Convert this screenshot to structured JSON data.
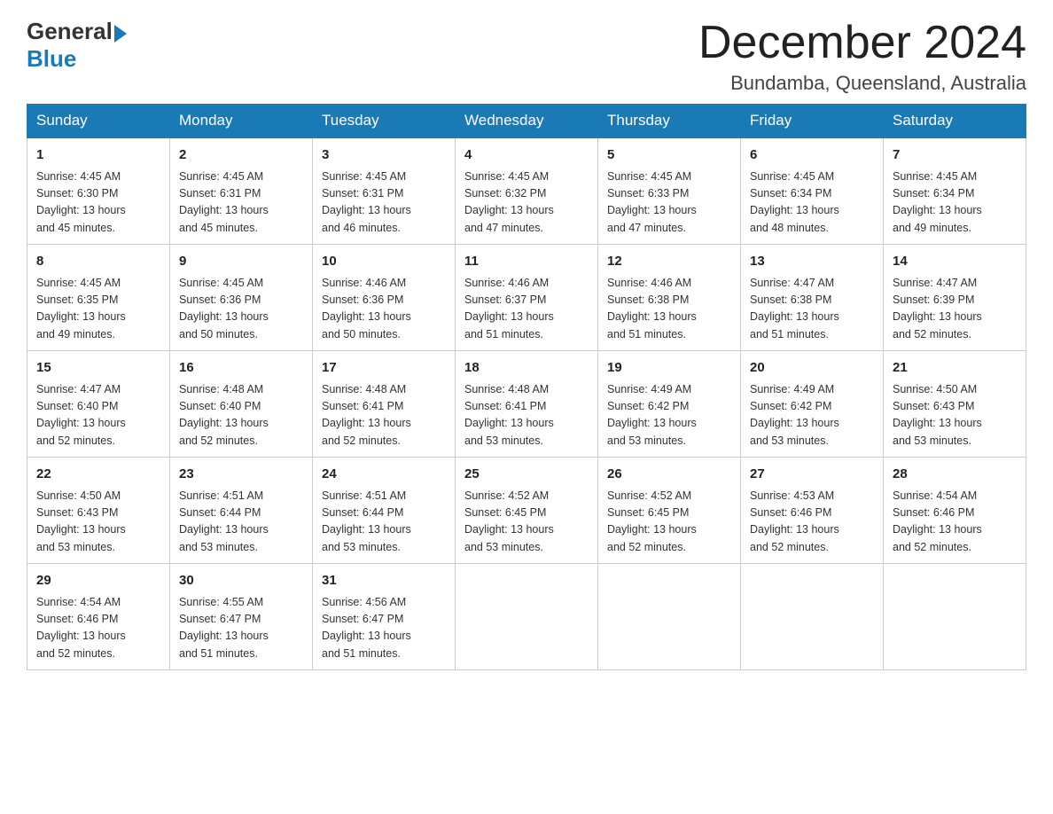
{
  "header": {
    "logo_general": "General",
    "logo_blue": "Blue",
    "title": "December 2024",
    "subtitle": "Bundamba, Queensland, Australia"
  },
  "days_of_week": [
    "Sunday",
    "Monday",
    "Tuesday",
    "Wednesday",
    "Thursday",
    "Friday",
    "Saturday"
  ],
  "weeks": [
    [
      {
        "day": "1",
        "sunrise": "4:45 AM",
        "sunset": "6:30 PM",
        "daylight": "13 hours and 45 minutes."
      },
      {
        "day": "2",
        "sunrise": "4:45 AM",
        "sunset": "6:31 PM",
        "daylight": "13 hours and 45 minutes."
      },
      {
        "day": "3",
        "sunrise": "4:45 AM",
        "sunset": "6:31 PM",
        "daylight": "13 hours and 46 minutes."
      },
      {
        "day": "4",
        "sunrise": "4:45 AM",
        "sunset": "6:32 PM",
        "daylight": "13 hours and 47 minutes."
      },
      {
        "day": "5",
        "sunrise": "4:45 AM",
        "sunset": "6:33 PM",
        "daylight": "13 hours and 47 minutes."
      },
      {
        "day": "6",
        "sunrise": "4:45 AM",
        "sunset": "6:34 PM",
        "daylight": "13 hours and 48 minutes."
      },
      {
        "day": "7",
        "sunrise": "4:45 AM",
        "sunset": "6:34 PM",
        "daylight": "13 hours and 49 minutes."
      }
    ],
    [
      {
        "day": "8",
        "sunrise": "4:45 AM",
        "sunset": "6:35 PM",
        "daylight": "13 hours and 49 minutes."
      },
      {
        "day": "9",
        "sunrise": "4:45 AM",
        "sunset": "6:36 PM",
        "daylight": "13 hours and 50 minutes."
      },
      {
        "day": "10",
        "sunrise": "4:46 AM",
        "sunset": "6:36 PM",
        "daylight": "13 hours and 50 minutes."
      },
      {
        "day": "11",
        "sunrise": "4:46 AM",
        "sunset": "6:37 PM",
        "daylight": "13 hours and 51 minutes."
      },
      {
        "day": "12",
        "sunrise": "4:46 AM",
        "sunset": "6:38 PM",
        "daylight": "13 hours and 51 minutes."
      },
      {
        "day": "13",
        "sunrise": "4:47 AM",
        "sunset": "6:38 PM",
        "daylight": "13 hours and 51 minutes."
      },
      {
        "day": "14",
        "sunrise": "4:47 AM",
        "sunset": "6:39 PM",
        "daylight": "13 hours and 52 minutes."
      }
    ],
    [
      {
        "day": "15",
        "sunrise": "4:47 AM",
        "sunset": "6:40 PM",
        "daylight": "13 hours and 52 minutes."
      },
      {
        "day": "16",
        "sunrise": "4:48 AM",
        "sunset": "6:40 PM",
        "daylight": "13 hours and 52 minutes."
      },
      {
        "day": "17",
        "sunrise": "4:48 AM",
        "sunset": "6:41 PM",
        "daylight": "13 hours and 52 minutes."
      },
      {
        "day": "18",
        "sunrise": "4:48 AM",
        "sunset": "6:41 PM",
        "daylight": "13 hours and 53 minutes."
      },
      {
        "day": "19",
        "sunrise": "4:49 AM",
        "sunset": "6:42 PM",
        "daylight": "13 hours and 53 minutes."
      },
      {
        "day": "20",
        "sunrise": "4:49 AM",
        "sunset": "6:42 PM",
        "daylight": "13 hours and 53 minutes."
      },
      {
        "day": "21",
        "sunrise": "4:50 AM",
        "sunset": "6:43 PM",
        "daylight": "13 hours and 53 minutes."
      }
    ],
    [
      {
        "day": "22",
        "sunrise": "4:50 AM",
        "sunset": "6:43 PM",
        "daylight": "13 hours and 53 minutes."
      },
      {
        "day": "23",
        "sunrise": "4:51 AM",
        "sunset": "6:44 PM",
        "daylight": "13 hours and 53 minutes."
      },
      {
        "day": "24",
        "sunrise": "4:51 AM",
        "sunset": "6:44 PM",
        "daylight": "13 hours and 53 minutes."
      },
      {
        "day": "25",
        "sunrise": "4:52 AM",
        "sunset": "6:45 PM",
        "daylight": "13 hours and 53 minutes."
      },
      {
        "day": "26",
        "sunrise": "4:52 AM",
        "sunset": "6:45 PM",
        "daylight": "13 hours and 52 minutes."
      },
      {
        "day": "27",
        "sunrise": "4:53 AM",
        "sunset": "6:46 PM",
        "daylight": "13 hours and 52 minutes."
      },
      {
        "day": "28",
        "sunrise": "4:54 AM",
        "sunset": "6:46 PM",
        "daylight": "13 hours and 52 minutes."
      }
    ],
    [
      {
        "day": "29",
        "sunrise": "4:54 AM",
        "sunset": "6:46 PM",
        "daylight": "13 hours and 52 minutes."
      },
      {
        "day": "30",
        "sunrise": "4:55 AM",
        "sunset": "6:47 PM",
        "daylight": "13 hours and 51 minutes."
      },
      {
        "day": "31",
        "sunrise": "4:56 AM",
        "sunset": "6:47 PM",
        "daylight": "13 hours and 51 minutes."
      },
      null,
      null,
      null,
      null
    ]
  ],
  "labels": {
    "sunrise_prefix": "Sunrise: ",
    "sunset_prefix": "Sunset: ",
    "daylight_prefix": "Daylight: "
  }
}
